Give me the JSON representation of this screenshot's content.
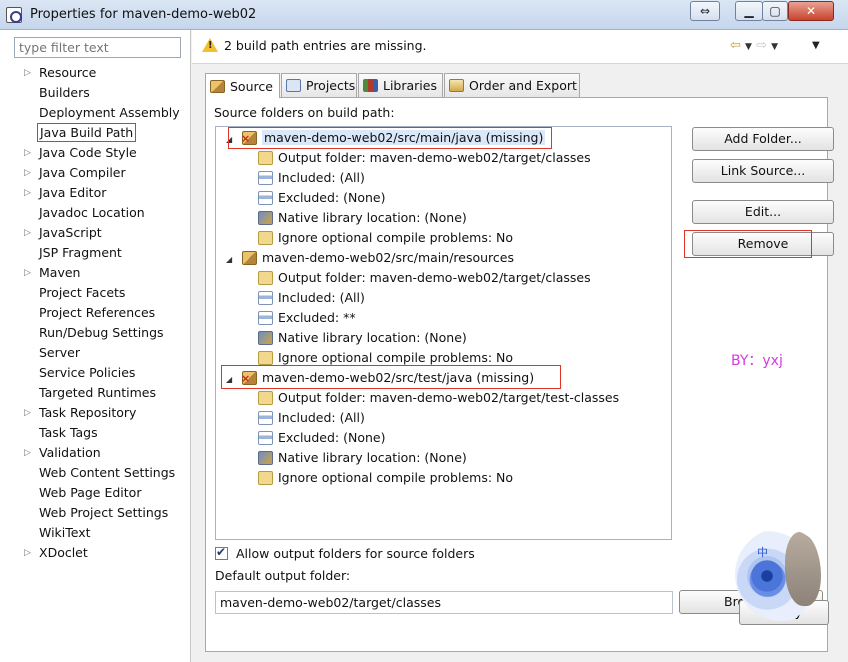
{
  "window": {
    "title": "Properties for maven-demo-web02"
  },
  "sidebar": {
    "filter_placeholder": "type filter text",
    "items": [
      {
        "label": "Resource",
        "expandable": true
      },
      {
        "label": "Builders",
        "expandable": false
      },
      {
        "label": "Deployment Assembly",
        "expandable": false
      },
      {
        "label": "Java Build Path",
        "expandable": false,
        "selected": true
      },
      {
        "label": "Java Code Style",
        "expandable": true
      },
      {
        "label": "Java Compiler",
        "expandable": true
      },
      {
        "label": "Java Editor",
        "expandable": true
      },
      {
        "label": "Javadoc Location",
        "expandable": false
      },
      {
        "label": "JavaScript",
        "expandable": true
      },
      {
        "label": "JSP Fragment",
        "expandable": false
      },
      {
        "label": "Maven",
        "expandable": true
      },
      {
        "label": "Project Facets",
        "expandable": false
      },
      {
        "label": "Project References",
        "expandable": false
      },
      {
        "label": "Run/Debug Settings",
        "expandable": false
      },
      {
        "label": "Server",
        "expandable": false
      },
      {
        "label": "Service Policies",
        "expandable": false
      },
      {
        "label": "Targeted Runtimes",
        "expandable": false
      },
      {
        "label": "Task Repository",
        "expandable": true
      },
      {
        "label": "Task Tags",
        "expandable": false
      },
      {
        "label": "Validation",
        "expandable": true
      },
      {
        "label": "Web Content Settings",
        "expandable": false
      },
      {
        "label": "Web Page Editor",
        "expandable": false
      },
      {
        "label": "Web Project Settings",
        "expandable": false
      },
      {
        "label": "WikiText",
        "expandable": false
      },
      {
        "label": "XDoclet",
        "expandable": true
      }
    ]
  },
  "message": {
    "text": "2 build path entries are missing."
  },
  "tabs": [
    {
      "label": "Source",
      "active": true
    },
    {
      "label": "Projects",
      "active": false
    },
    {
      "label": "Libraries",
      "active": false
    },
    {
      "label": "Order and Export",
      "active": false
    }
  ],
  "source": {
    "header": "Source folders on build path:",
    "tree": [
      {
        "text": "maven-demo-web02/src/main/java (missing)",
        "level": 0,
        "icon": "package-missing-icon",
        "selected": true
      },
      {
        "text": "Output folder: maven-demo-web02/target/classes",
        "level": 1,
        "icon": "output-folder-icon"
      },
      {
        "text": "Included: (All)",
        "level": 1,
        "icon": "included-filter-icon"
      },
      {
        "text": "Excluded: (None)",
        "level": 1,
        "icon": "excluded-filter-icon"
      },
      {
        "text": "Native library location: (None)",
        "level": 1,
        "icon": "native-library-icon"
      },
      {
        "text": "Ignore optional compile problems: No",
        "level": 1,
        "icon": "ignore-problems-icon"
      },
      {
        "text": "maven-demo-web02/src/main/resources",
        "level": 0,
        "icon": "package-icon"
      },
      {
        "text": "Output folder: maven-demo-web02/target/classes",
        "level": 1,
        "icon": "output-folder-icon"
      },
      {
        "text": "Included: (All)",
        "level": 1,
        "icon": "included-filter-icon"
      },
      {
        "text": "Excluded: **",
        "level": 1,
        "icon": "excluded-filter-icon"
      },
      {
        "text": "Native library location: (None)",
        "level": 1,
        "icon": "native-library-icon"
      },
      {
        "text": "Ignore optional compile problems: No",
        "level": 1,
        "icon": "ignore-problems-icon"
      },
      {
        "text": "maven-demo-web02/src/test/java (missing)",
        "level": 0,
        "icon": "package-missing-icon"
      },
      {
        "text": "Output folder: maven-demo-web02/target/test-classes",
        "level": 1,
        "icon": "output-folder-icon"
      },
      {
        "text": "Included: (All)",
        "level": 1,
        "icon": "included-filter-icon"
      },
      {
        "text": "Excluded: (None)",
        "level": 1,
        "icon": "excluded-filter-icon"
      },
      {
        "text": "Native library location: (None)",
        "level": 1,
        "icon": "native-library-icon"
      },
      {
        "text": "Ignore optional compile problems: No",
        "level": 1,
        "icon": "ignore-problems-icon"
      }
    ],
    "buttons": {
      "add_folder": "Add Folder...",
      "link_source": "Link Source...",
      "edit": "Edit...",
      "remove": "Remove",
      "browse": "Bro"
    },
    "allow_output_label": "Allow output folders for source folders",
    "allow_output_checked": true,
    "default_output_label": "Default output folder:",
    "default_output_value": "maven-demo-web02/target/classes"
  },
  "annotation": {
    "byline": "BY：yxj",
    "avatar_char": "中"
  },
  "footer": {
    "apply": "Apply"
  },
  "colors": {
    "highlight_box": "#e0362a",
    "byline": "#d639e0",
    "warning": "#f2c02c"
  }
}
